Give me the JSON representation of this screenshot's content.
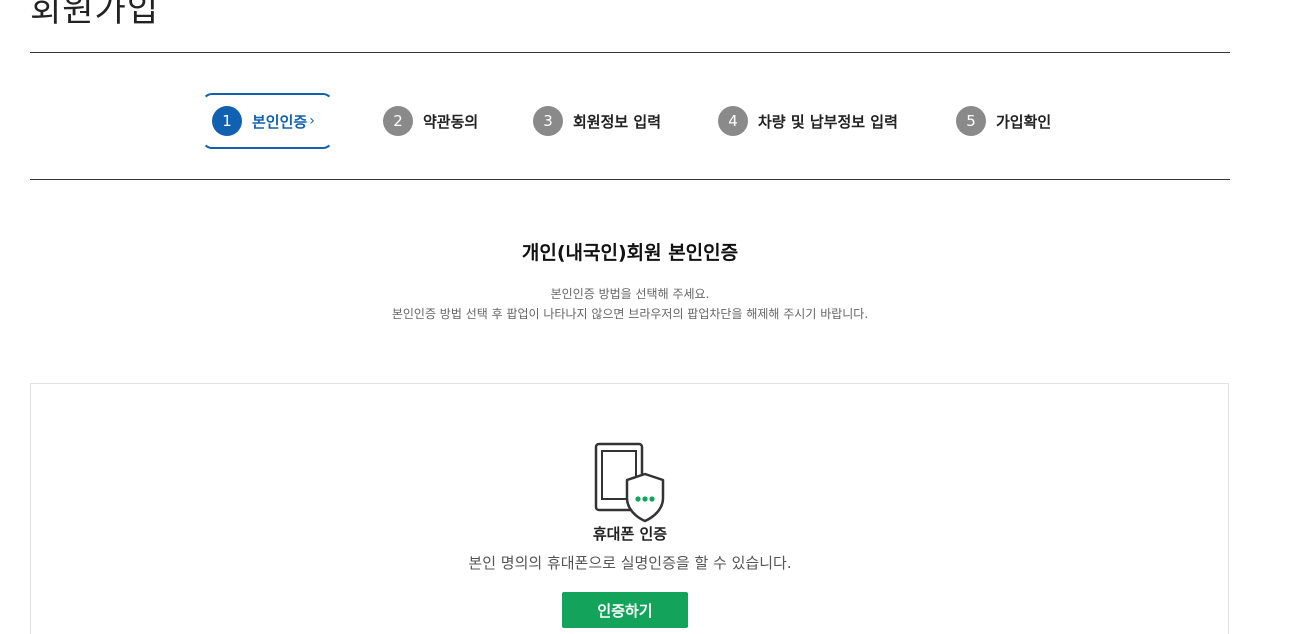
{
  "page": {
    "title": "회원가입"
  },
  "steps": [
    {
      "number": "1",
      "label": "본인인증",
      "chevron": "›",
      "active": true
    },
    {
      "number": "2",
      "label": "약관동의",
      "active": false
    },
    {
      "number": "3",
      "label": "회원정보 입력",
      "active": false
    },
    {
      "number": "4",
      "label": "차량 및 납부정보 입력",
      "active": false
    },
    {
      "number": "5",
      "label": "가입확인",
      "active": false
    }
  ],
  "section": {
    "heading": "개인(내국인)회원 본인인증",
    "notice_line1": "본인인증 방법을 선택해 주세요.",
    "notice_line2": "본인인증 방법 선택 후 팝업이 나타나지 않으면 브라우저의 팝업차단을 해제해 주시기 바랍니다."
  },
  "auth_option": {
    "icon": "mobile-phone-shield-icon",
    "title": "휴대폰 인증",
    "description": "본인 명의의 휴대폰으로 실명인증을 할 수 있습니다.",
    "button_label": "인증하기"
  },
  "colors": {
    "active_step": "#1261b0",
    "inactive_step": "#8a8a8a",
    "primary_button": "#13a35a",
    "icon_dots": "#13a35a"
  }
}
